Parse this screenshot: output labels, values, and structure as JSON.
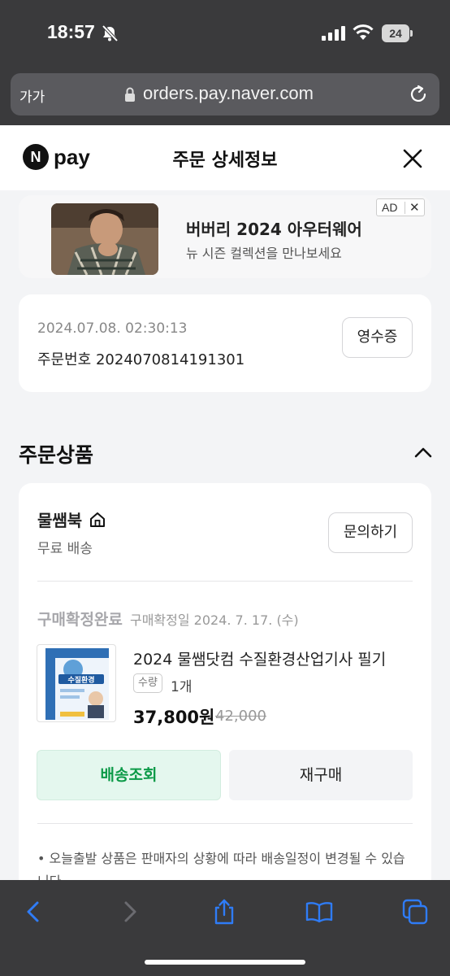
{
  "status_bar": {
    "time": "18:57",
    "battery": "24"
  },
  "browser": {
    "text_size_label": "가가",
    "url": "orders.pay.naver.com"
  },
  "header": {
    "logo_letter": "N",
    "logo_text": "pay",
    "title": "주문 상세정보"
  },
  "ad": {
    "title": "버버리 2024 아우터웨어",
    "subtitle": "뉴 시즌 컬렉션을 만나보세요",
    "badge": "AD",
    "close": "✕"
  },
  "order": {
    "datetime": "2024.07.08. 02:30:13",
    "order_number": "주문번호 2024070814191301",
    "receipt_label": "영수증"
  },
  "section": {
    "title": "주문상품"
  },
  "product": {
    "seller": "물쌤북",
    "shipping": "무료 배송",
    "inquiry_label": "문의하기",
    "status": "구매확정완료",
    "confirm_date": "구매확정일 2024. 7. 17. (수)",
    "name": "2024 물쌤닷컴 수질환경산업기사 필기",
    "qty_label": "수량",
    "qty": "1개",
    "price": "37,800원",
    "original_price": "42,000",
    "cover_title": "수질환경",
    "track_label": "배송조회",
    "rebuy_label": "재구매",
    "note": "• 오늘출발 상품은 판매자의 상황에 따라 배송일정이 변경될 수 있습니다."
  },
  "colors": {
    "accent_green": "#0c9a48",
    "track_bg": "#e4f7ee",
    "chrome": "#3a3a3c",
    "toolbar_icon": "#2f7cf6"
  }
}
